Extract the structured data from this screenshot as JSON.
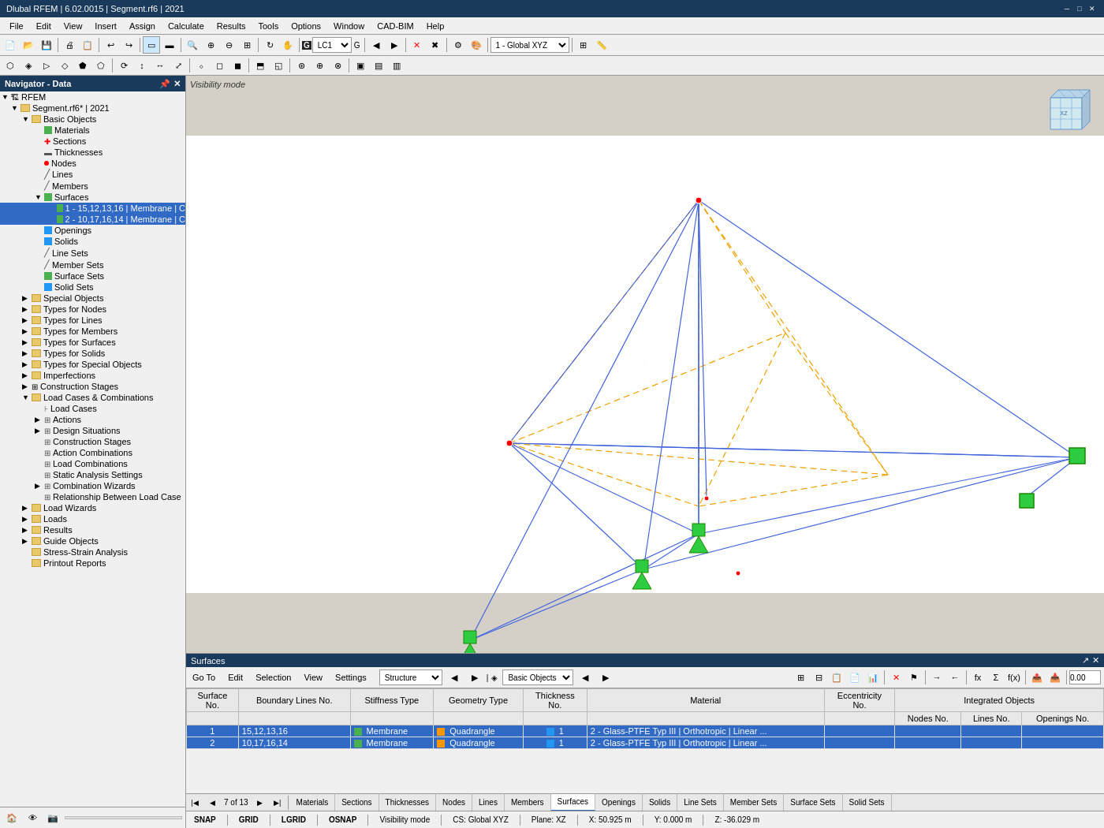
{
  "titleBar": {
    "title": "Dlubal RFEM | 6.02.0015 | Segment.rf6 | 2021",
    "controls": [
      "─",
      "□",
      "✕"
    ]
  },
  "menuBar": {
    "items": [
      "File",
      "Edit",
      "View",
      "Insert",
      "Assign",
      "Calculate",
      "Results",
      "Tools",
      "Options",
      "Window",
      "CAD-BIM",
      "Help"
    ]
  },
  "navigator": {
    "header": "Navigator - Data",
    "tree": [
      {
        "id": "rfem",
        "label": "RFEM",
        "level": 0,
        "expanded": true,
        "icon": "rfem"
      },
      {
        "id": "segment",
        "label": "Segment.rf6* | 2021",
        "level": 1,
        "expanded": true,
        "icon": "folder"
      },
      {
        "id": "basic-objects",
        "label": "Basic Objects",
        "level": 2,
        "expanded": true,
        "icon": "folder"
      },
      {
        "id": "materials",
        "label": "Materials",
        "level": 3,
        "icon": "sq-green"
      },
      {
        "id": "sections",
        "label": "Sections",
        "level": 3,
        "icon": "section"
      },
      {
        "id": "thicknesses",
        "label": "Thicknesses",
        "level": 3,
        "icon": "thickness"
      },
      {
        "id": "nodes",
        "label": "Nodes",
        "level": 3,
        "icon": "dot-red"
      },
      {
        "id": "lines",
        "label": "Lines",
        "level": 3,
        "icon": "line"
      },
      {
        "id": "members",
        "label": "Members",
        "level": 3,
        "icon": "member"
      },
      {
        "id": "surfaces",
        "label": "Surfaces",
        "level": 3,
        "expanded": true,
        "icon": "sq-green"
      },
      {
        "id": "surface-1",
        "label": "1 - 15,12,13,16 | Membrane | C",
        "level": 4,
        "icon": "sq-green",
        "selected": false
      },
      {
        "id": "surface-2",
        "label": "2 - 10,17,16,14 | Membrane | C",
        "level": 4,
        "icon": "sq-green",
        "selected": false
      },
      {
        "id": "openings",
        "label": "Openings",
        "level": 3,
        "icon": "sq-blue"
      },
      {
        "id": "solids",
        "label": "Solids",
        "level": 3,
        "icon": "sq-blue"
      },
      {
        "id": "line-sets",
        "label": "Line Sets",
        "level": 3,
        "icon": "line"
      },
      {
        "id": "member-sets",
        "label": "Member Sets",
        "level": 3,
        "icon": "member"
      },
      {
        "id": "surface-sets",
        "label": "Surface Sets",
        "level": 3,
        "icon": "sq-green"
      },
      {
        "id": "solid-sets",
        "label": "Solid Sets",
        "level": 3,
        "icon": "sq-blue"
      },
      {
        "id": "special-objects",
        "label": "Special Objects",
        "level": 2,
        "icon": "folder"
      },
      {
        "id": "types-nodes",
        "label": "Types for Nodes",
        "level": 2,
        "icon": "folder"
      },
      {
        "id": "types-lines",
        "label": "Types for Lines",
        "level": 2,
        "icon": "folder"
      },
      {
        "id": "types-members",
        "label": "Types for Members",
        "level": 2,
        "icon": "folder"
      },
      {
        "id": "types-surfaces",
        "label": "Types for Surfaces",
        "level": 2,
        "icon": "folder"
      },
      {
        "id": "types-solids",
        "label": "Types for Solids",
        "level": 2,
        "icon": "folder"
      },
      {
        "id": "types-special",
        "label": "Types for Special Objects",
        "level": 2,
        "icon": "folder"
      },
      {
        "id": "imperfections",
        "label": "Imperfections",
        "level": 2,
        "icon": "folder"
      },
      {
        "id": "construction-stages",
        "label": "Construction Stages",
        "level": 2,
        "icon": "folder"
      },
      {
        "id": "load-cases-comb",
        "label": "Load Cases & Combinations",
        "level": 2,
        "expanded": true,
        "icon": "folder"
      },
      {
        "id": "load-cases",
        "label": "Load Cases",
        "level": 3,
        "icon": "load"
      },
      {
        "id": "actions",
        "label": "Actions",
        "level": 3,
        "icon": "action"
      },
      {
        "id": "design-situations",
        "label": "Design Situations",
        "level": 3,
        "icon": "design"
      },
      {
        "id": "construction-stages-2",
        "label": "Construction Stages",
        "level": 3,
        "icon": "folder"
      },
      {
        "id": "action-combinations",
        "label": "Action Combinations",
        "level": 3,
        "icon": "action"
      },
      {
        "id": "load-combinations",
        "label": "Load Combinations",
        "level": 3,
        "icon": "load"
      },
      {
        "id": "static-analysis",
        "label": "Static Analysis Settings",
        "level": 3,
        "icon": "settings"
      },
      {
        "id": "combination-wizards",
        "label": "Combination Wizards",
        "level": 3,
        "icon": "wizard"
      },
      {
        "id": "relationship-load",
        "label": "Relationship Between Load Case",
        "level": 3,
        "icon": "relation"
      },
      {
        "id": "load-wizards",
        "label": "Load Wizards",
        "level": 2,
        "icon": "folder"
      },
      {
        "id": "loads",
        "label": "Loads",
        "level": 2,
        "icon": "folder"
      },
      {
        "id": "results",
        "label": "Results",
        "level": 2,
        "icon": "folder"
      },
      {
        "id": "guide-objects",
        "label": "Guide Objects",
        "level": 2,
        "icon": "folder"
      },
      {
        "id": "stress-strain",
        "label": "Stress-Strain Analysis",
        "level": 2,
        "icon": "folder"
      },
      {
        "id": "printout",
        "label": "Printout Reports",
        "level": 2,
        "icon": "folder"
      }
    ]
  },
  "toolbar1": {
    "lcLabel": "G",
    "lcDropdown": "LC1",
    "lcValue": "G",
    "viewDropdown": "1 - Global XYZ"
  },
  "viewport": {
    "label": "Visibility mode"
  },
  "surfacesPanel": {
    "title": "Surfaces",
    "menus": [
      "Go To",
      "Edit",
      "Selection",
      "View",
      "Settings"
    ],
    "filter1": "Structure",
    "filter2": "Basic Objects",
    "columns": [
      "Surface No.",
      "Boundary Lines No.",
      "Stiffness Type",
      "Geometry Type",
      "Thickness No.",
      "Material",
      "Eccentricity No.",
      "Nodes No.",
      "Integrated Objects Lines No.",
      "Openings No."
    ],
    "rows": [
      {
        "no": 1,
        "boundaryLines": "15,12,13,16",
        "stiffnessType": "Membrane",
        "stiffColor": "#4CAF50",
        "geometryType": "Quadrangle",
        "geoColor": "#FF9800",
        "thicknessNo": 1,
        "thicknessColor": "#2196F3",
        "material": "2 - Glass-PTFE Typ III | Orthotropic | Linear ...",
        "eccNo": "",
        "nodesNo": "",
        "intLines": "",
        "openings": "",
        "selected": true
      },
      {
        "no": 2,
        "boundaryLines": "10,17,16,14",
        "stiffnessType": "Membrane",
        "stiffColor": "#4CAF50",
        "geometryType": "Quadrangle",
        "geoColor": "#FF9800",
        "thicknessNo": 1,
        "thicknessColor": "#2196F3",
        "material": "2 - Glass-PTFE Typ III | Orthotropic | Linear ...",
        "eccNo": "",
        "nodesNo": "",
        "intLines": "",
        "openings": "",
        "selected": true
      }
    ]
  },
  "tabs": [
    "Materials",
    "Sections",
    "Thicknesses",
    "Nodes",
    "Lines",
    "Members",
    "Surfaces",
    "Openings",
    "Solids",
    "Line Sets",
    "Member Sets",
    "Surface Sets",
    "Solid Sets"
  ],
  "activeTab": "Surfaces",
  "pageNav": {
    "current": "7",
    "total": "13"
  },
  "statusBar": {
    "snap": "SNAP",
    "grid": "GRID",
    "lgrid": "LGRID",
    "osnap": "OSNAP",
    "visMode": "Visibility mode",
    "cs": "CS: Global XYZ",
    "plane": "Plane: XZ",
    "x": "X: 50.925 m",
    "y": "Y: 0.000 m",
    "z": "Z: -36.029 m"
  }
}
